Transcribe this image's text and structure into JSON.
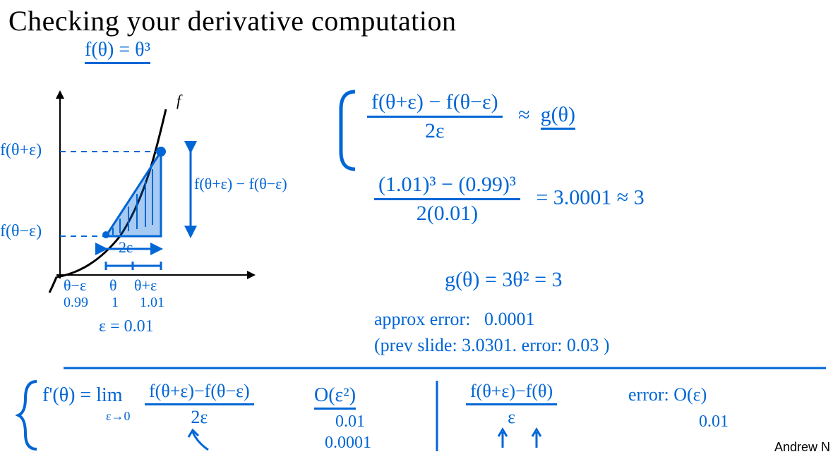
{
  "title": "Checking your derivative computation",
  "func_def": "f(θ) = θ³",
  "plot": {
    "f_label": "f",
    "y_top": "f(θ+ε)",
    "y_bot": "f(θ−ε)",
    "brace_diff": "f(θ+ε) − f(θ−ε)",
    "width": "2ε",
    "x1": "θ−ε",
    "x2": "θ",
    "x3": "θ+ε",
    "n1": "0.99",
    "n2": "1",
    "n3": "1.01",
    "eps": "ε = 0.01"
  },
  "right": {
    "approx_num": "f(θ+ε) − f(θ−ε)",
    "approx_den": "2ε",
    "approx_sym": "≈",
    "g": "g(θ)",
    "calc_num": "(1.01)³ − (0.99)³",
    "calc_den": "2(0.01)",
    "calc_eq": "=  3.0001  ≈ 3",
    "g_val": "g(θ) = 3θ² = 3",
    "err_lbl": "approx error:",
    "err_val": " 0.0001",
    "prev": "(prev slide: 3.0301.   error: 0.03 )"
  },
  "bottom": {
    "lim_left": "f'(θ) = lim",
    "lim_sub": "ε→0",
    "lim_frac_num": "f(θ+ε)−f(θ−ε)",
    "lim_frac_den": "2ε",
    "oe2": "O(ε²)",
    "oe2_a": "0.01",
    "oe2_b": "0.0001",
    "one_num": "f(θ+ε)−f(θ)",
    "one_den": "ε",
    "one_err": "error:  O(ε)",
    "one_v": "0.01"
  },
  "attribution": "Andrew N"
}
